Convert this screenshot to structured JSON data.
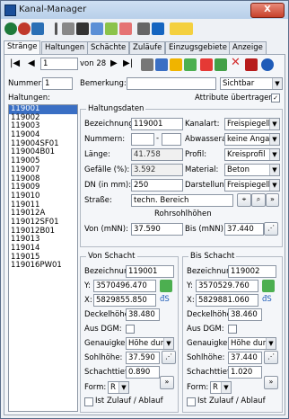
{
  "window": {
    "title": "Kanal-Manager",
    "close_label": "X"
  },
  "tabs": [
    "Stränge",
    "Haltungen",
    "Schächte",
    "Zuläufe",
    "Einzugsgebiete",
    "Anzeige"
  ],
  "nav": {
    "record": "1",
    "of_total": "von 28"
  },
  "header": {
    "nummer_label": "Nummer:",
    "nummer_value": "1",
    "bemerkung_label": "Bemerkung:",
    "bemerkung_value": "",
    "sichtbar_value": "Sichtbar",
    "haltungen_label": "Haltungen:",
    "attribute_label": "Attribute übertragen",
    "attribute_checked": "✓"
  },
  "haltungen_list": [
    "119001",
    "119002",
    "119003",
    "119004",
    "119004SF01",
    "119004B01",
    "119005",
    "119007",
    "119008",
    "119009",
    "119010",
    "119011",
    "119012A",
    "119012SF01",
    "119012B01",
    "119013",
    "119014",
    "119015",
    "119016PW01"
  ],
  "haltungsdaten": {
    "title": "Haltungsdaten",
    "bezeichnung_label": "Bezeichnung:",
    "bezeichnung_value": "119001",
    "kanalart_label": "Kanalart:",
    "kanalart_value": "Freispiegelkanal",
    "nummern_label": "Nummern:",
    "nummern_value1": "",
    "nummern_value2": "",
    "abwasserart_label": "Abwasserart:",
    "abwasserart_value": "keine Angabe",
    "laenge_label": "Länge:",
    "laenge_value": "41.758",
    "profil_label": "Profil:",
    "profil_value": "Kreisprofil",
    "gefaelle_label": "Gefälle (%):",
    "gefaelle_value": "3.592",
    "material_label": "Material:",
    "material_value": "Beton",
    "dn_label": "DN (in mm):",
    "dn_value": "250",
    "darstellung_label": "Darstellung:",
    "darstellung_value": "Freispiegelkanal",
    "strasse_label": "Straße:",
    "strasse_value": "techn. Bereich",
    "rohrsohl_title": "Rohrsohlhöhen",
    "von_label": "Von (mNN):",
    "von_value": "37.590",
    "bis_label": "Bis (mNN):",
    "bis_value": "37.440",
    "more_label": "»"
  },
  "von_schacht": {
    "title": "Von Schacht",
    "bezeichnung_label": "Bezeichnung:",
    "bezeichnung_value": "119001",
    "y_label": "Y:",
    "y_value": "3570496.470",
    "x_label": "X:",
    "x_value": "5829855.850",
    "deckel_label": "Deckelhöhe:",
    "deckel_value": "38.480",
    "dgm_label": "Aus DGM:",
    "genauigkeit_label": "Genauigkeit:",
    "genauigkeit_value": "Höhe durch",
    "sohl_label": "Sohlhöhe:",
    "sohl_value": "37.590",
    "tiefe_label": "Schachttiefe:",
    "tiefe_value": "0.890",
    "form_label": "Form:",
    "form_value": "R",
    "zulauf_label": "Ist Zulauf / Ablauf",
    "more_label": "»"
  },
  "bis_schacht": {
    "title": "Bis Schacht",
    "bezeichnung_label": "Bezeichnung:",
    "bezeichnung_value": "119002",
    "y_label": "Y:",
    "y_value": "3570529.760",
    "x_label": "X:",
    "x_value": "5829881.060",
    "deckel_label": "Deckelhöhe:",
    "deckel_value": "38.460",
    "dgm_label": "Aus DGM:",
    "genauigkeit_label": "Genauigkeit:",
    "genauigkeit_value": "Höhe durch",
    "sohl_label": "Sohlhöhe:",
    "sohl_value": "37.440",
    "tiefe_label": "Schachttiefe:",
    "tiefe_value": "1.020",
    "form_label": "Form:",
    "form_value": "R",
    "zulauf_label": "Ist Zulauf / Ablauf",
    "more_label": "»"
  },
  "colors": {
    "selection": "#3a6fc4",
    "title_close": "#c7412b"
  }
}
